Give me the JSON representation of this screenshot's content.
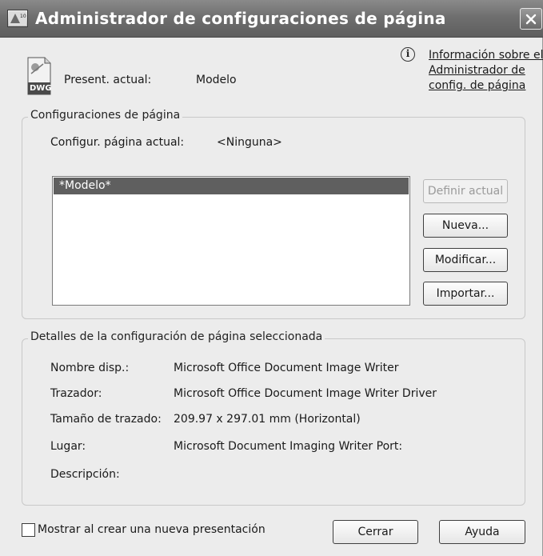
{
  "window": {
    "title": "Administrador de configuraciones de página",
    "app_icon": "autocad-app-icon",
    "close_icon": "close-icon"
  },
  "header": {
    "dwg_icon_label": "DWG",
    "current_layout_label": "Present. actual:",
    "current_layout_value": "Modelo",
    "info_link": "Información sobre el Administrador de config. de página"
  },
  "page_setups": {
    "group_title": "Configuraciones de página",
    "current_setup_label": "Configur. página actual:",
    "current_setup_value": "<Ninguna>",
    "list_items": [
      "*Modelo*"
    ],
    "selected_index": 0,
    "buttons": {
      "set_current": "Definir actual",
      "new": "Nueva...",
      "modify": "Modificar...",
      "import": "Importar..."
    }
  },
  "details": {
    "group_title": "Detalles de la configuración de página seleccionada",
    "rows": [
      {
        "label": "Nombre disp.:",
        "value": "Microsoft Office Document Image Writer"
      },
      {
        "label": "Trazador:",
        "value": "Microsoft Office Document Image Writer Driver"
      },
      {
        "label": "Tamaño de trazado:",
        "value": "209.97 x 297.01 mm (Horizontal)"
      },
      {
        "label": "Lugar:",
        "value": "Microsoft Document Imaging Writer Port:"
      },
      {
        "label": "Descripción:",
        "value": ""
      }
    ]
  },
  "footer": {
    "show_on_create_label": "Mostrar al crear una nueva presentación",
    "show_on_create_checked": false,
    "close_button": "Cerrar",
    "help_button": "Ayuda"
  },
  "colors": {
    "titlebar": "#6f6f6f",
    "selection": "#5f5f5f",
    "window_bg": "#ececec"
  }
}
